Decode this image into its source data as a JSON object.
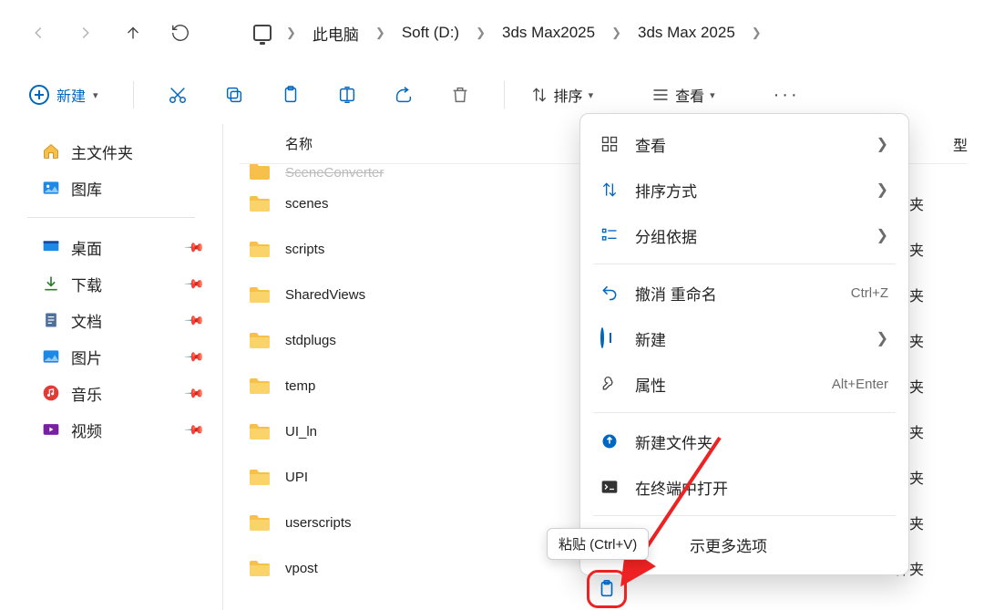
{
  "addressbar": {
    "crumbs": [
      "此电脑",
      "Soft (D:)",
      "3ds Max2025",
      "3ds Max 2025"
    ]
  },
  "toolbar": {
    "new_label": "新建",
    "sort_label": "排序",
    "view_label": "查看"
  },
  "sidebar": {
    "home": "主文件夹",
    "gallery": "图库",
    "pinned": [
      {
        "label": "桌面"
      },
      {
        "label": "下载"
      },
      {
        "label": "文档"
      },
      {
        "label": "图片"
      },
      {
        "label": "音乐"
      },
      {
        "label": "视频"
      }
    ]
  },
  "list": {
    "col_name": "名称",
    "col_type_frag": "型",
    "type_folder": "件夹",
    "cutoff_item": "SceneConverter",
    "items": [
      "scenes",
      "scripts",
      "SharedViews",
      "stdplugs",
      "temp",
      "UI_ln",
      "UPI",
      "userscripts",
      "vpost"
    ]
  },
  "context_menu": {
    "view": "查看",
    "sort": "排序方式",
    "group": "分组依据",
    "undo": "撤消 重命名",
    "undo_sc": "Ctrl+Z",
    "new": "新建",
    "props": "属性",
    "props_sc": "Alt+Enter",
    "new_folder": "新建文件夹",
    "terminal": "在终端中打开",
    "more": "示更多选项"
  },
  "tooltip": {
    "text": "粘贴 (Ctrl+V)"
  }
}
